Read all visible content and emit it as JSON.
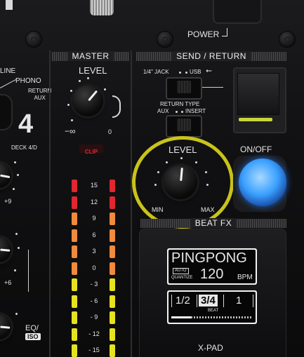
{
  "top": {
    "power_label": "POWER"
  },
  "left_panel": {
    "line_label": "LINE",
    "phono_label": "PHONO",
    "return_aux_label": "RETURN\nAUX",
    "deck_number": "4",
    "deck_label": "DECK 4/D",
    "gain_mark": "+9",
    "eq_mark": "+6",
    "eq_iso_label": "EQ/",
    "iso_label": "ISO"
  },
  "master": {
    "header": "MASTER",
    "level_label": "LEVEL",
    "min_label": "−∞",
    "max_label": "0",
    "clip_label": "CLIP",
    "meter_scale": [
      "15",
      "12",
      "9",
      "6",
      "3",
      "0",
      "- 3",
      "- 6",
      "- 9",
      "- 12",
      "- 15"
    ]
  },
  "send_return": {
    "header": "SEND / RETURN",
    "jack_label": "1/4\" JACK",
    "usb_label": "USB",
    "return_type_label": "RETURN TYPE",
    "aux_label": "AUX",
    "insert_label": "INSERT",
    "level_label": "LEVEL",
    "min_label": "MIN",
    "max_label": "MAX",
    "on_off_label": "ON/OFF"
  },
  "beat_fx": {
    "header": "BEAT FX",
    "effect_name": "PINGPONG",
    "auto_label": "AUTO",
    "quantize_label": "QUANTIZE",
    "bpm_value": "120",
    "bpm_unit": "BPM",
    "beat_options": [
      "1/2",
      "3/4",
      "1"
    ],
    "selected_beat": "3/4",
    "beat_label": "BEAT",
    "xpad_label": "X-PAD"
  },
  "colors": {
    "highlight_ring": "#c9c31a",
    "on_off_button": "#3aa0ff",
    "meter_red": "#e0262f",
    "meter_orange": "#f08a3c",
    "meter_yellow": "#e6e21e",
    "clip_red": "#e0262f"
  }
}
